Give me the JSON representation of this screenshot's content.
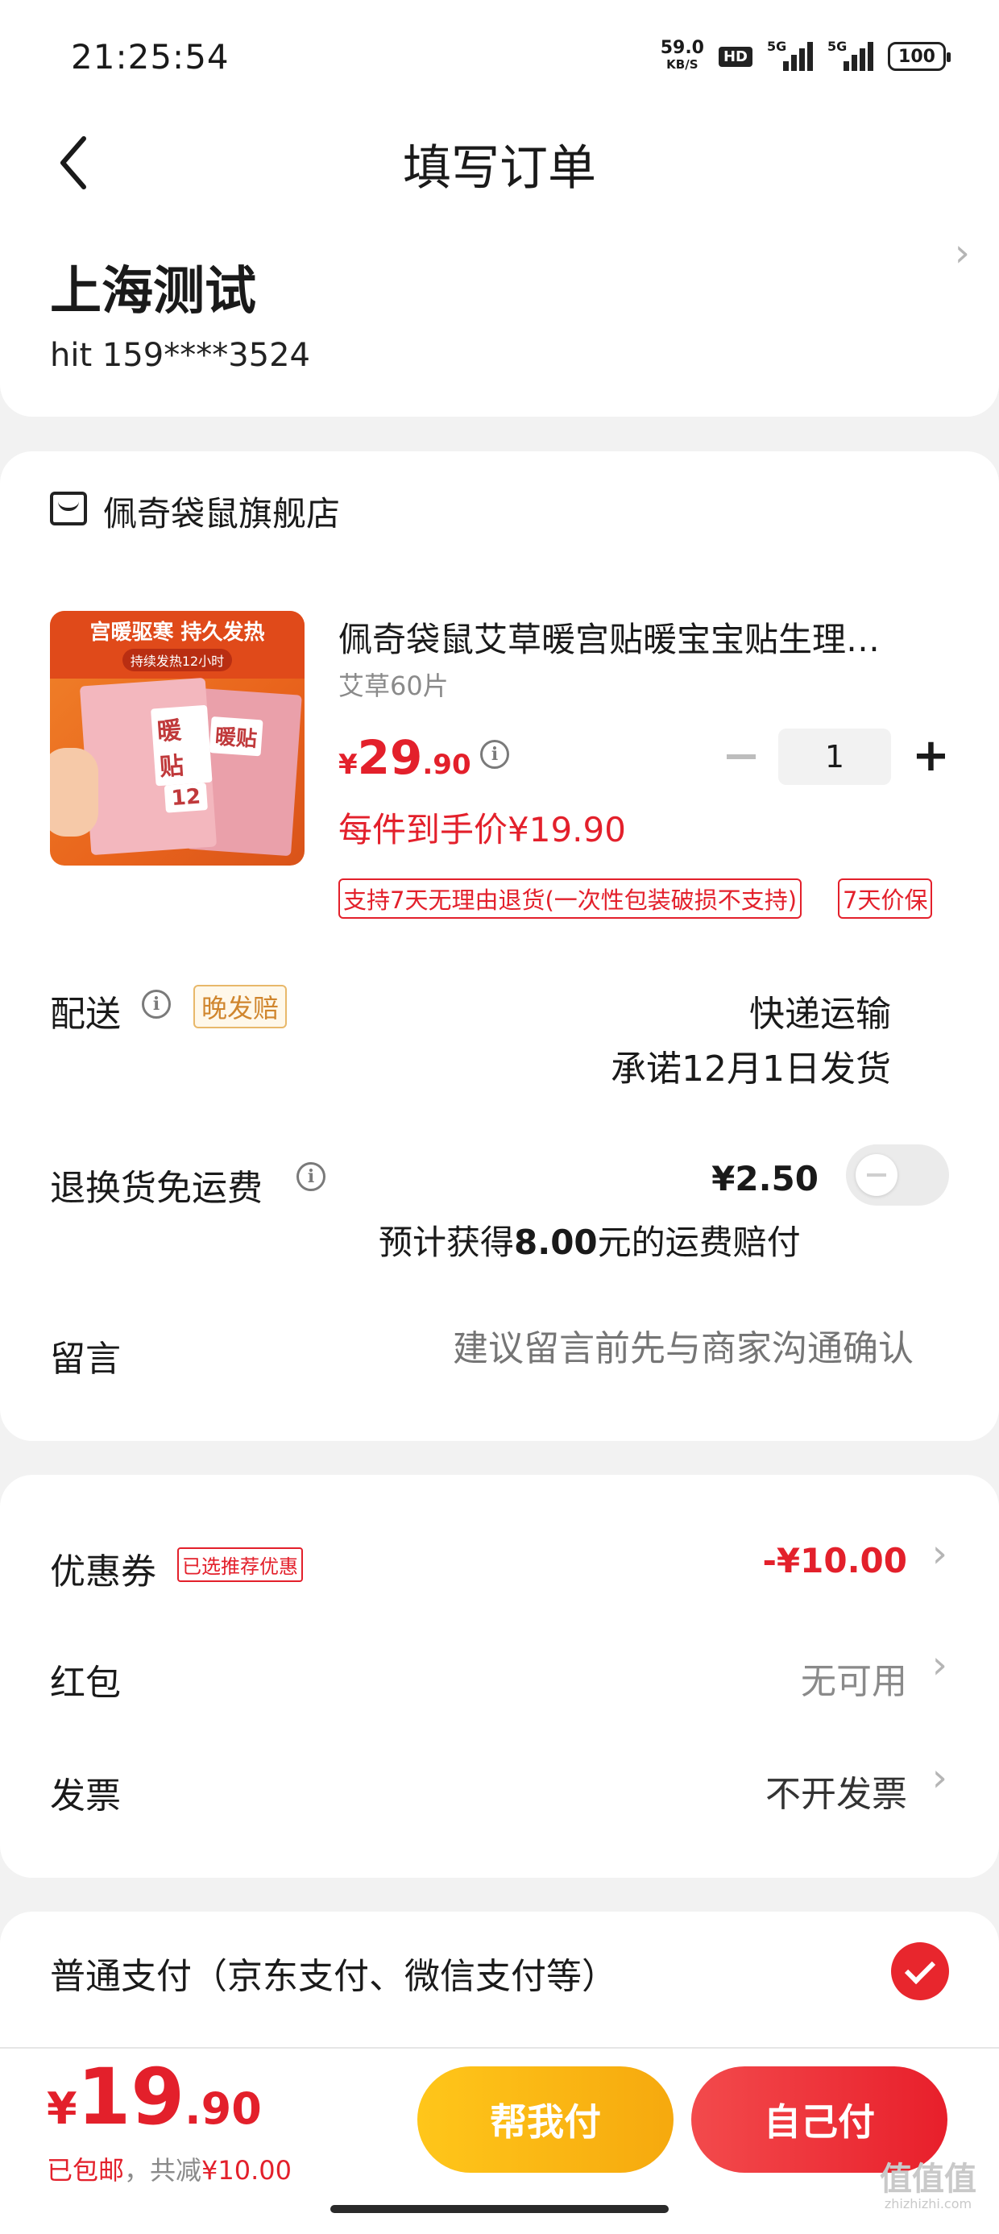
{
  "status_bar": {
    "time": "21:25:54",
    "net_speed": "59.0",
    "net_unit": "KB/S",
    "hd": "HD",
    "sim1": "5G",
    "sim2": "5G",
    "battery": "100"
  },
  "header": {
    "title": "填写订单"
  },
  "address": {
    "region": "上海测试",
    "contact": "hit  159****3524"
  },
  "shop": {
    "name": "佩奇袋鼠旗舰店"
  },
  "product": {
    "title": "佩奇袋鼠艾草暖宫贴暖宝宝贴生理…",
    "spec": "艾草60片",
    "price_symbol": "¥",
    "price_int": "29",
    "price_dec": ".90",
    "quantity": "1",
    "hand_price": "每件到手价¥19.90",
    "tag_return": "支持7天无理由退货(一次性包装破损不支持)",
    "tag_price": "7天价保",
    "image_text": {
      "headline": "宫暖驱寒  持久发热",
      "subline": "持续发热12小时",
      "box_label": "暖贴",
      "box_number": "12"
    }
  },
  "delivery": {
    "label": "配送",
    "late_tag": "晚发赔",
    "mode": "快递运输",
    "promise": "承诺12月1日发货"
  },
  "freight_insurance": {
    "label": "退换货免运费",
    "price": "¥2.50",
    "comp_prefix": "预计获得",
    "comp_amount": "8.00",
    "comp_suffix": "元的运费赔付",
    "enabled": false
  },
  "message": {
    "label": "留言",
    "placeholder": "建议留言前先与商家沟通确认"
  },
  "coupon": {
    "label": "优惠券",
    "badge": "已选推荐优惠",
    "value": "-¥10.00"
  },
  "red_packet": {
    "label": "红包",
    "value": "无可用"
  },
  "invoice": {
    "label": "发票",
    "value": "不开发票"
  },
  "payment": {
    "label": "普通支付（京东支付、微信支付等）",
    "selected": true
  },
  "footer": {
    "total_symbol": "¥",
    "total_int": "19",
    "total_dec": ".90",
    "shipping": "已包邮",
    "sep": "，",
    "discount_prefix": "共减",
    "discount": "¥10.00",
    "help_pay": "帮我付",
    "self_pay": "自己付"
  },
  "watermark": {
    "logo": "值值值",
    "url": "zhizhizhi.com"
  },
  "colors": {
    "accent_red": "#e3202b",
    "yellow": "#f6a90e",
    "background": "#f2f2f2"
  }
}
